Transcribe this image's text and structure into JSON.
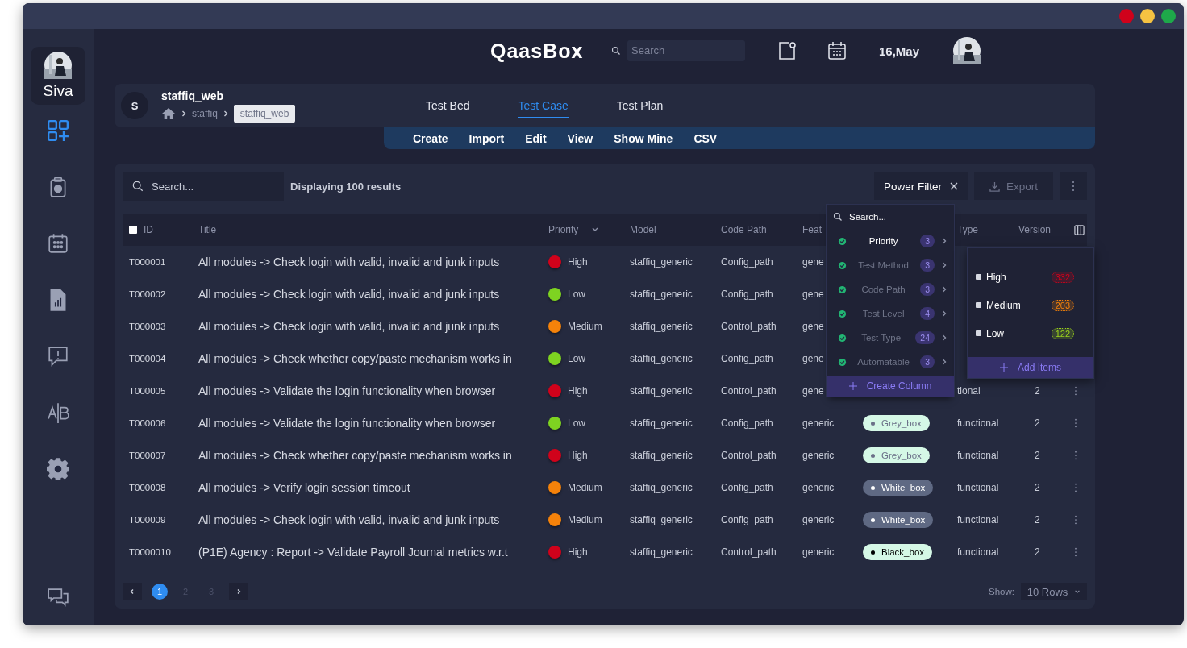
{
  "window": {
    "controls": [
      {
        "color": "#d0021b"
      },
      {
        "color": "#f5c242"
      },
      {
        "color": "#1ea84a"
      }
    ]
  },
  "sidebar": {
    "user": {
      "name": "Siva"
    },
    "items": [
      {
        "kind": "dashboard",
        "selected": true
      },
      {
        "kind": "clipboard",
        "selected": false
      },
      {
        "kind": "calendar",
        "selected": false
      },
      {
        "kind": "report",
        "selected": false
      },
      {
        "kind": "alert",
        "selected": false
      },
      {
        "kind": "ab",
        "selected": false
      },
      {
        "kind": "settings",
        "selected": false
      },
      {
        "kind": "chat",
        "selected": false
      }
    ]
  },
  "header": {
    "logo": "QaasBox",
    "search": {
      "placeholder": "Search"
    },
    "date": "16,May"
  },
  "project": {
    "initial": "S",
    "name": "staffiq_web",
    "breadcrumb": [
      "staffiq",
      "staffiq_web"
    ]
  },
  "tabs": [
    {
      "label": "Test Bed",
      "selected": false
    },
    {
      "label": "Test Case",
      "selected": true
    },
    {
      "label": "Test Plan",
      "selected": false
    }
  ],
  "actions": [
    "Create",
    "Import",
    "Edit",
    "View",
    "Show Mine",
    "CSV"
  ],
  "toolbar": {
    "search": {
      "placeholder": "Search..."
    },
    "result_count": "Displaying 100 results",
    "power_filter": "Power Filter",
    "export": {
      "label": "Export",
      "disabled": true
    }
  },
  "table": {
    "select_all": {
      "checked": false
    },
    "columns": {
      "id": "ID",
      "title": "Title",
      "priority": "Priority",
      "model": "Model",
      "code_path": "Code Path",
      "feature": "Feat",
      "type": "Type",
      "version": "Version"
    },
    "rows": [
      {
        "id": "T000001",
        "title": "All modules -> Check login with valid, invalid and junk inputs",
        "priority": {
          "label": "High",
          "color": "#d0021b"
        },
        "model": "staffiq_generic",
        "code_path": "Config_path",
        "feature": "gene"
      },
      {
        "id": "T000002",
        "title": "All modules -> Check login with valid, invalid and junk inputs",
        "priority": {
          "label": "Low",
          "color": "#7ed321"
        },
        "model": "staffiq_generic",
        "code_path": "Config_path",
        "feature": "gene"
      },
      {
        "id": "T000003",
        "title": "All modules -> Check login with valid, invalid and junk inputs",
        "priority": {
          "label": "Medium",
          "color": "#f5820a"
        },
        "model": "staffiq_generic",
        "code_path": "Control_path",
        "feature": "gene"
      },
      {
        "id": "T000004",
        "title": "All modules -> Check whether copy/paste mechanism works in",
        "priority": {
          "label": "Low",
          "color": "#7ed321"
        },
        "model": "staffiq_generic",
        "code_path": "Config_path",
        "feature": "gene"
      },
      {
        "id": "T000005",
        "title": "All modules -> Validate the login functionality when browser",
        "priority": {
          "label": "High",
          "color": "#d0021b"
        },
        "model": "staffiq_generic",
        "code_path": "Control_path",
        "feature": "gene",
        "type": "tional",
        "version": "2"
      },
      {
        "id": "T000006",
        "title": "All modules -> Validate the login functionality when browser",
        "priority": {
          "label": "Low",
          "color": "#7ed321"
        },
        "model": "staffiq_generic",
        "code_path": "Config_path",
        "feature": "generic",
        "test_method": {
          "label": "Grey_box",
          "kind": "grey"
        },
        "type": "functional",
        "version": "2"
      },
      {
        "id": "T000007",
        "title": "All modules -> Check whether copy/paste mechanism works in",
        "priority": {
          "label": "High",
          "color": "#d0021b"
        },
        "model": "staffiq_generic",
        "code_path": "Control_path",
        "feature": "generic",
        "test_method": {
          "label": "Grey_box",
          "kind": "grey"
        },
        "type": "functional",
        "version": "2"
      },
      {
        "id": "T000008",
        "title": "All modules -> Verify login session timeout",
        "priority": {
          "label": "Medium",
          "color": "#f5820a"
        },
        "model": "staffiq_generic",
        "code_path": "Config_path",
        "feature": "generic",
        "test_method": {
          "label": "White_box",
          "kind": "white"
        },
        "type": "functional",
        "version": "2"
      },
      {
        "id": "T000009",
        "title": "All modules -> Check login with valid, invalid and junk inputs",
        "priority": {
          "label": "Medium",
          "color": "#f5820a"
        },
        "model": "staffiq_generic",
        "code_path": "Config_path",
        "feature": "generic",
        "test_method": {
          "label": "White_box",
          "kind": "white"
        },
        "type": "functional",
        "version": "2"
      },
      {
        "id": "T0000010",
        "title": "(P1E) Agency : Report -> Validate Payroll Journal metrics w.r.t",
        "priority": {
          "label": "High",
          "color": "#d0021b"
        },
        "model": "staffiq_generic",
        "code_path": "Control_path",
        "feature": "generic",
        "test_method": {
          "label": "Black_box",
          "kind": "black"
        },
        "type": "functional",
        "version": "2"
      }
    ]
  },
  "filter_menu": {
    "search": {
      "placeholder": "Search..."
    },
    "items": [
      {
        "label": "Priority",
        "count": "3",
        "checked": true,
        "selected": true
      },
      {
        "label": "Test Method",
        "count": "3",
        "checked": true,
        "selected": false
      },
      {
        "label": "Code Path",
        "count": "3",
        "checked": true,
        "selected": false
      },
      {
        "label": "Test Level",
        "count": "4",
        "checked": true,
        "selected": false
      },
      {
        "label": "Test Type",
        "count": "24",
        "checked": true,
        "selected": false
      },
      {
        "label": "Automatable",
        "count": "3",
        "checked": true,
        "selected": false
      }
    ],
    "footer": "Create Column"
  },
  "submenu": {
    "items": [
      {
        "label": "High",
        "count": "332",
        "checked": false,
        "color": "#d0021b"
      },
      {
        "label": "Medium",
        "count": "203",
        "checked": false,
        "color": "#f5820a"
      },
      {
        "label": "Low",
        "count": "122",
        "checked": false,
        "color": "#9ad11d"
      }
    ],
    "footer": "Add Items"
  },
  "pagination": {
    "pages": [
      {
        "label": "1",
        "selected": true
      },
      {
        "label": "2",
        "selected": false
      },
      {
        "label": "3",
        "selected": false
      }
    ],
    "show_label": "Show:",
    "rows": "10 Rows"
  }
}
